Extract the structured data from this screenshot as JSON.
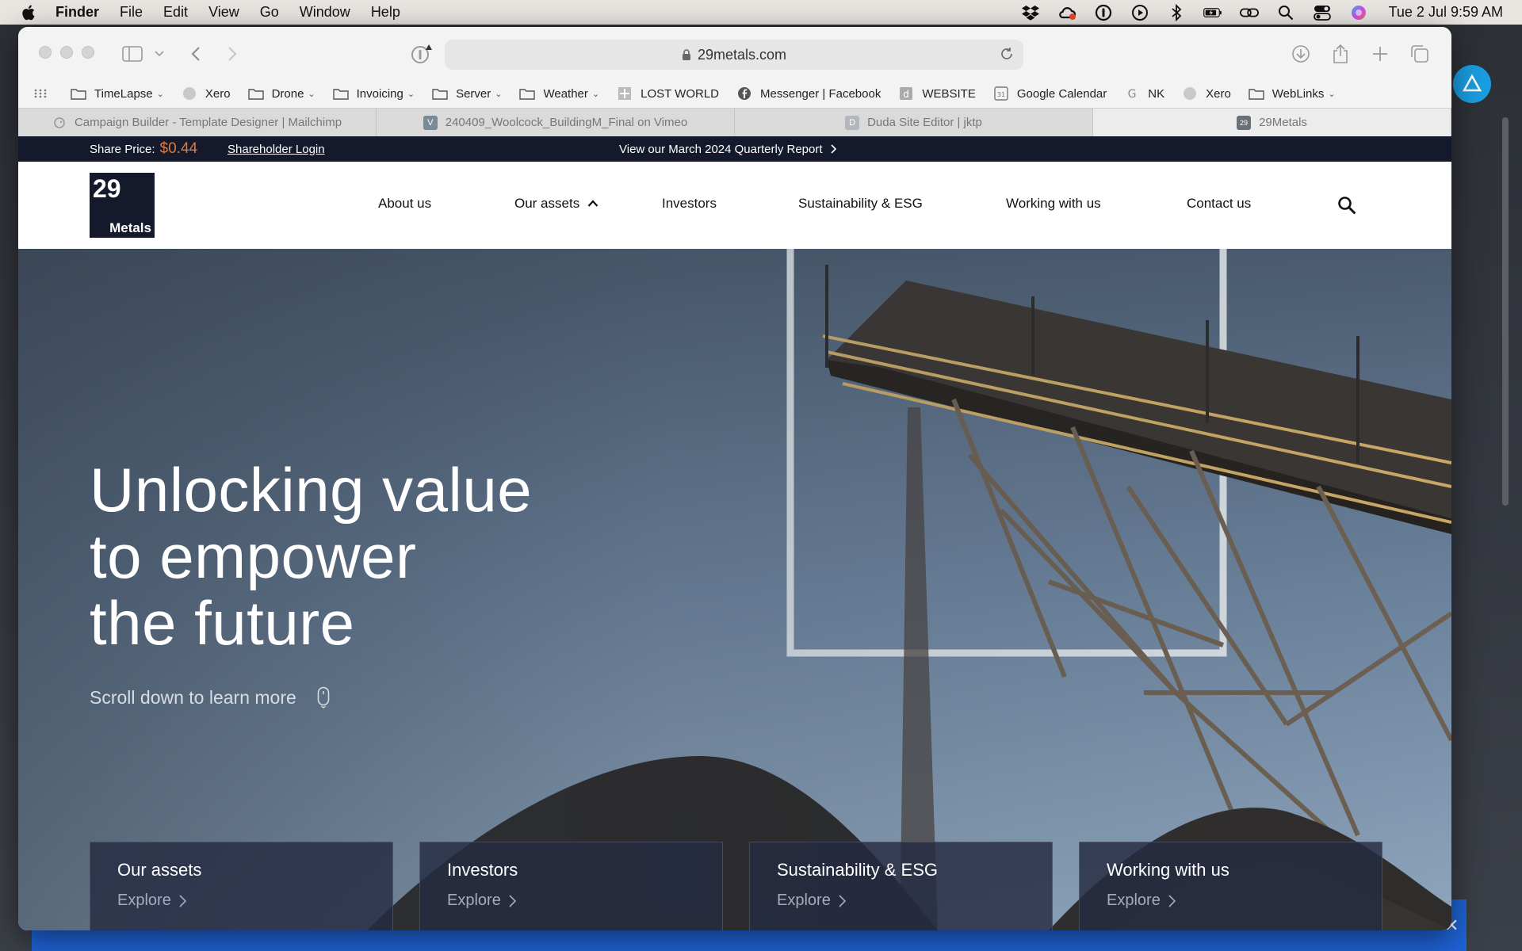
{
  "menubar": {
    "app": "Finder",
    "items": [
      "File",
      "Edit",
      "View",
      "Go",
      "Window",
      "Help"
    ],
    "status_icons": [
      "dropbox-icon",
      "creative-cloud-icon",
      "onepassword-icon",
      "play-icon",
      "bluetooth-icon",
      "battery-icon",
      "link-icon",
      "search-icon",
      "control-center-icon",
      "siri-icon"
    ],
    "clock": "Tue 2 Jul  9:59 AM"
  },
  "browser": {
    "url": "29metals.com",
    "bookmarks": [
      {
        "label": "TimeLapse",
        "icon": "folder-icon",
        "folder": true
      },
      {
        "label": "Xero",
        "icon": "xero-icon",
        "folder": false
      },
      {
        "label": "Drone",
        "icon": "folder-icon",
        "folder": true
      },
      {
        "label": "Invoicing",
        "icon": "folder-icon",
        "folder": true
      },
      {
        "label": "Server",
        "icon": "folder-icon",
        "folder": true
      },
      {
        "label": "Weather",
        "icon": "folder-icon",
        "folder": true
      },
      {
        "label": "LOST WORLD",
        "icon": "plus-icon",
        "folder": false
      },
      {
        "label": "Messenger | Facebook",
        "icon": "facebook-icon",
        "folder": false
      },
      {
        "label": "WEBSITE",
        "icon": "duda-icon",
        "folder": false
      },
      {
        "label": "Google Calendar",
        "icon": "calendar-icon",
        "folder": false
      },
      {
        "label": "NK",
        "icon": "google-icon",
        "folder": false
      },
      {
        "label": "Xero",
        "icon": "xero-icon",
        "folder": false
      },
      {
        "label": "WebLinks",
        "icon": "folder-icon",
        "folder": true
      }
    ],
    "tabs": [
      {
        "label": "Campaign Builder - Template Designer | Mailchimp",
        "icon": "mailchimp-icon",
        "color": "#888888"
      },
      {
        "label": "240409_Woolcock_BuildingM_Final on Vimeo",
        "icon": "vimeo-icon",
        "color": "#7a8a96"
      },
      {
        "label": "Duda Site Editor | jktp",
        "icon": "duda-icon",
        "color": "#9aa0a6"
      },
      {
        "label": "29Metals",
        "icon": "29metals-icon",
        "color": "#6b6f78"
      }
    ]
  },
  "site": {
    "share_label": "Share Price:",
    "share_price": "$0.44",
    "login": "Shareholder Login",
    "report": "View our March 2024 Quarterly Report",
    "logo_num": "29",
    "logo_word": "Metals",
    "nav": [
      "About us",
      "Our assets",
      "Investors",
      "Sustainability & ESG",
      "Working with us",
      "Contact us"
    ],
    "hero_lines": [
      "Unlocking value",
      "to empower",
      "the future"
    ],
    "scroll": "Scroll down to learn more",
    "cards": [
      {
        "title": "Our assets",
        "link": "Explore"
      },
      {
        "title": "Investors",
        "link": "Explore"
      },
      {
        "title": "Sustainability & ESG",
        "link": "Explore"
      },
      {
        "title": "Working with us",
        "link": "Explore"
      }
    ]
  },
  "colors": {
    "navy": "#15192c",
    "price_orange": "#e07a3a",
    "card_bg": "#252b42",
    "banner_blue": "#1e63d6"
  }
}
